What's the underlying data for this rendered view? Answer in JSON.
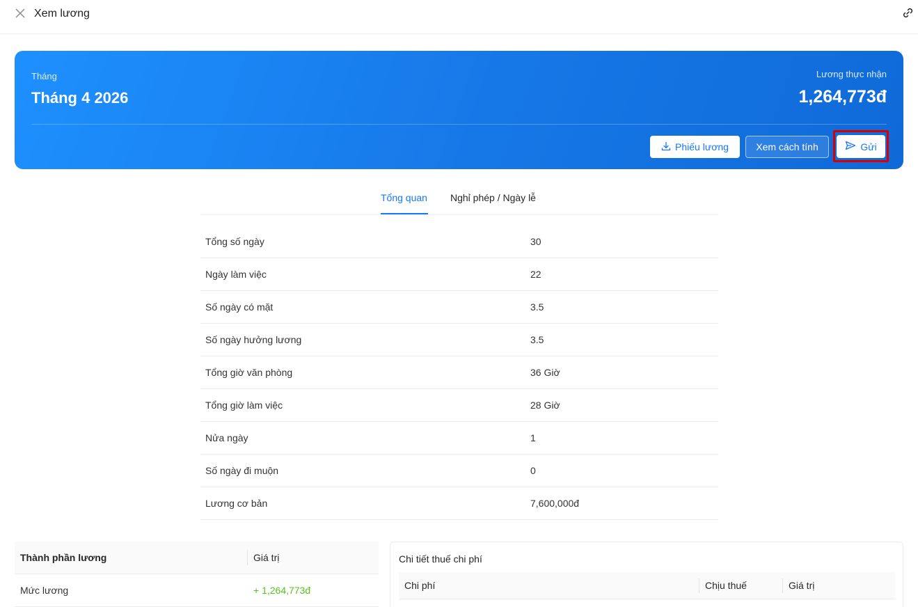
{
  "header": {
    "title": "Xem lương"
  },
  "banner": {
    "month_label": "Tháng",
    "month_value": "Tháng 4 2026",
    "net_label": "Lương thực nhận",
    "net_value": "1,264,773đ",
    "buttons": {
      "payslip": "Phiếu lương",
      "calc": "Xem cách tính",
      "send": "Gửi"
    }
  },
  "tabs": [
    {
      "label": "Tổng quan",
      "active": true
    },
    {
      "label": "Nghỉ phép / Ngày lễ",
      "active": false
    }
  ],
  "overview": [
    {
      "label": "Tổng số ngày",
      "value": "30"
    },
    {
      "label": "Ngày làm việc",
      "value": "22"
    },
    {
      "label": "Số ngày có mặt",
      "value": "3.5"
    },
    {
      "label": "Số ngày hưởng lương",
      "value": "3.5"
    },
    {
      "label": "Tổng giờ văn phòng",
      "value": "36 Giờ"
    },
    {
      "label": "Tổng giờ làm việc",
      "value": "28 Giờ"
    },
    {
      "label": "Nửa ngày",
      "value": "1"
    },
    {
      "label": "Số ngày đi muộn",
      "value": "0"
    },
    {
      "label": "Lương cơ bản",
      "value": "7,600,000đ"
    }
  ],
  "components": {
    "headers": [
      "Thành phần lương",
      "Giá trị"
    ],
    "rows": [
      {
        "name": "Mức lương",
        "value": "+ 1,264,773đ"
      }
    ]
  },
  "tax": {
    "title": "Chi tiết thuế chi phí",
    "headers": [
      "Chi phí",
      "Chịu thuế",
      "Giá trị"
    ]
  },
  "colors": {
    "accent": "#1677ff",
    "banner_start": "#1e90ff",
    "banner_end": "#0f6ad8",
    "positive": "#52c41a",
    "highlight": "#d90000"
  }
}
